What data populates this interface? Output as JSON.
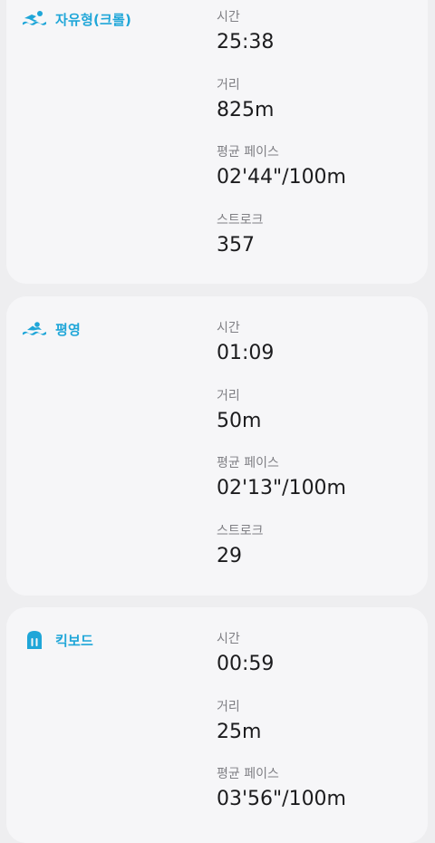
{
  "colors": {
    "accent": "#1fa6d8",
    "card_background": "#f6f6f8",
    "page_background": "#eeeef0",
    "label_text": "#7f7f84",
    "value_text": "#1c1c1e"
  },
  "strokes": [
    {
      "name": "자유형(크롤)",
      "icon": "freestyle-swimmer-icon",
      "metrics": [
        {
          "label": "시간",
          "value": "25:38"
        },
        {
          "label": "거리",
          "value": "825m"
        },
        {
          "label": "평균 페이스",
          "value": "02'44\"/100m"
        },
        {
          "label": "스트로크",
          "value": "357"
        }
      ]
    },
    {
      "name": "평영",
      "icon": "breaststroke-swimmer-icon",
      "metrics": [
        {
          "label": "시간",
          "value": "01:09"
        },
        {
          "label": "거리",
          "value": "50m"
        },
        {
          "label": "평균 페이스",
          "value": "02'13\"/100m"
        },
        {
          "label": "스트로크",
          "value": "29"
        }
      ]
    },
    {
      "name": "킥보드",
      "icon": "kickboard-icon",
      "metrics": [
        {
          "label": "시간",
          "value": "00:59"
        },
        {
          "label": "거리",
          "value": "25m"
        },
        {
          "label": "평균 페이스",
          "value": "03'56\"/100m"
        }
      ]
    }
  ]
}
